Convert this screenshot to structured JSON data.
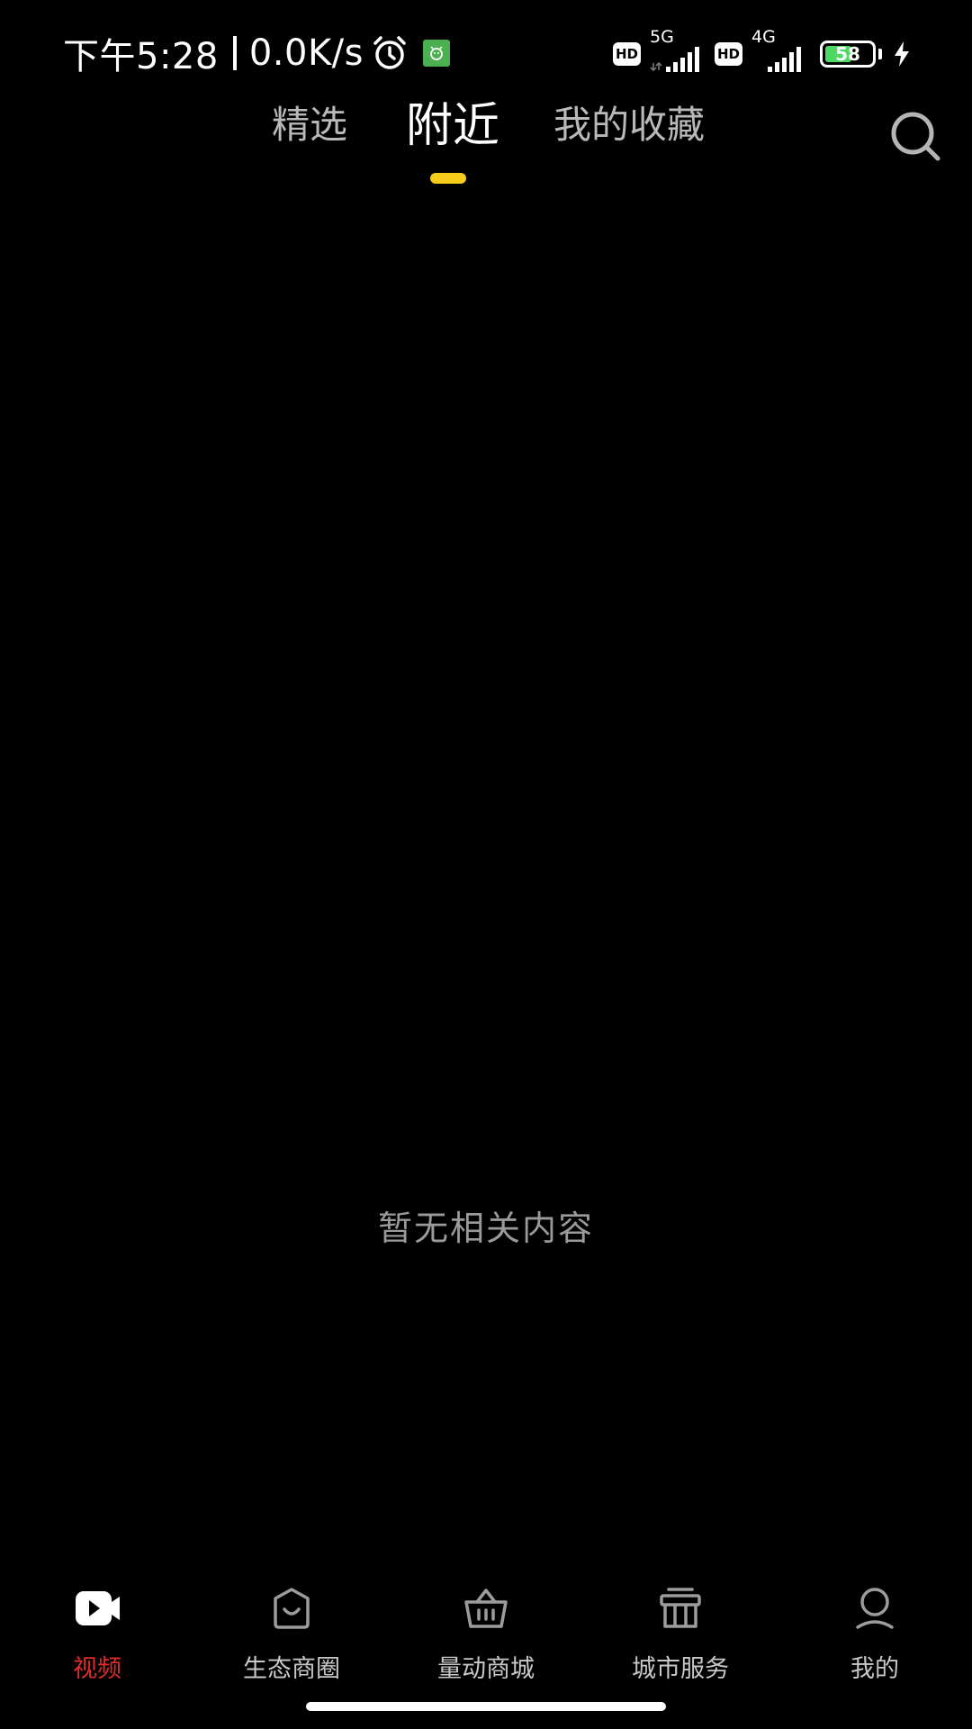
{
  "status_bar": {
    "time": "下午5:28",
    "net_speed": "0.0K/s",
    "hd_badge_1": "HD",
    "network_1": "5G",
    "hd_badge_2": "HD",
    "network_2": "4G",
    "battery_level": "58",
    "battery_fraction": 0.58,
    "icons": [
      "alarm-icon",
      "app-notification-icon",
      "signal-icon",
      "battery-icon",
      "charging-icon"
    ]
  },
  "tabs": [
    {
      "label": "精选",
      "active": false
    },
    {
      "label": "附近",
      "active": true
    },
    {
      "label": "我的收藏",
      "active": false
    }
  ],
  "search": {
    "icon": "search-icon"
  },
  "empty_state": {
    "message": "暂无相关内容"
  },
  "bottom_nav": [
    {
      "label": "视频",
      "icon": "video-icon",
      "active": true
    },
    {
      "label": "生态商圈",
      "icon": "bag-icon",
      "active": false
    },
    {
      "label": "量动商城",
      "icon": "basket-icon",
      "active": false
    },
    {
      "label": "城市服务",
      "icon": "gift-box-icon",
      "active": false
    },
    {
      "label": "我的",
      "icon": "user-icon",
      "active": false
    }
  ],
  "colors": {
    "background": "#000000",
    "tab_indicator": "#f5cc1a",
    "active_nav": "#e02a2a",
    "battery_fill": "#4cd964"
  }
}
